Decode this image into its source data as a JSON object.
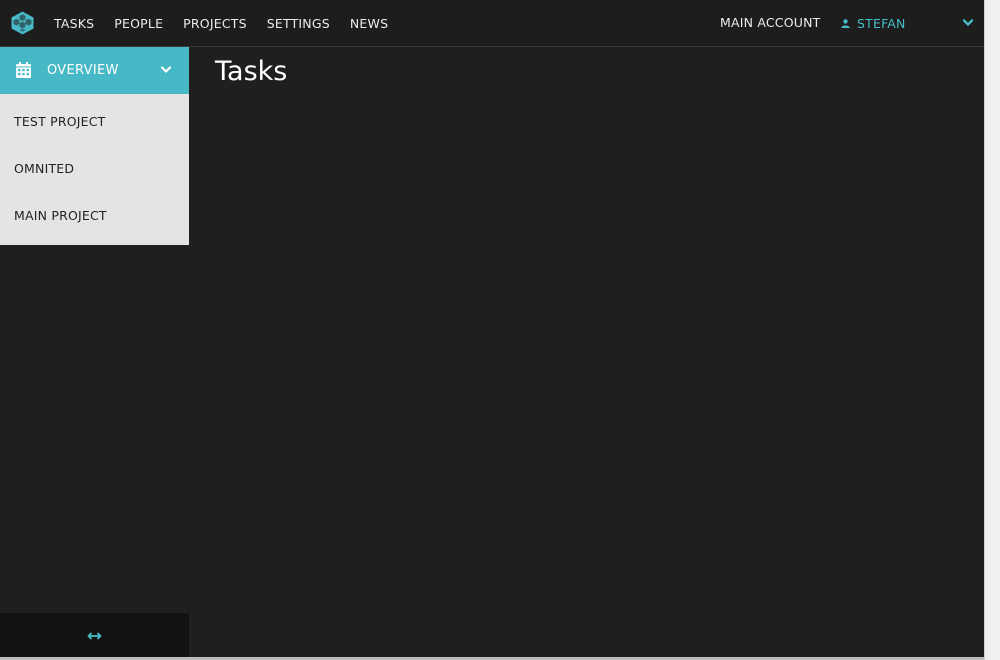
{
  "colors": {
    "accent": "#47b8c6",
    "background": "#1f1f1f",
    "topbar": "#1d1d1d",
    "sidebar_list": "#e4e4e4"
  },
  "topbar": {
    "logo_icon": "hexagon-cluster-logo-icon",
    "nav": [
      {
        "label": "TASKS"
      },
      {
        "label": "PEOPLE"
      },
      {
        "label": "PROJECTS"
      },
      {
        "label": "SETTINGS"
      },
      {
        "label": "NEWS"
      }
    ],
    "account_label": "MAIN ACCOUNT",
    "user": {
      "icon": "person-icon",
      "name": "STEFAN",
      "menu_icon": "chevron-down-icon"
    }
  },
  "sidebar": {
    "header": {
      "icon": "calendar-icon",
      "label": "OVERVIEW",
      "toggle_icon": "chevron-down-icon"
    },
    "projects": [
      {
        "label": "TEST PROJECT"
      },
      {
        "label": "OMNITED"
      },
      {
        "label": "MAIN PROJECT"
      }
    ],
    "footer_icon": "resize-horizontal-icon"
  },
  "main": {
    "title": "Tasks"
  }
}
